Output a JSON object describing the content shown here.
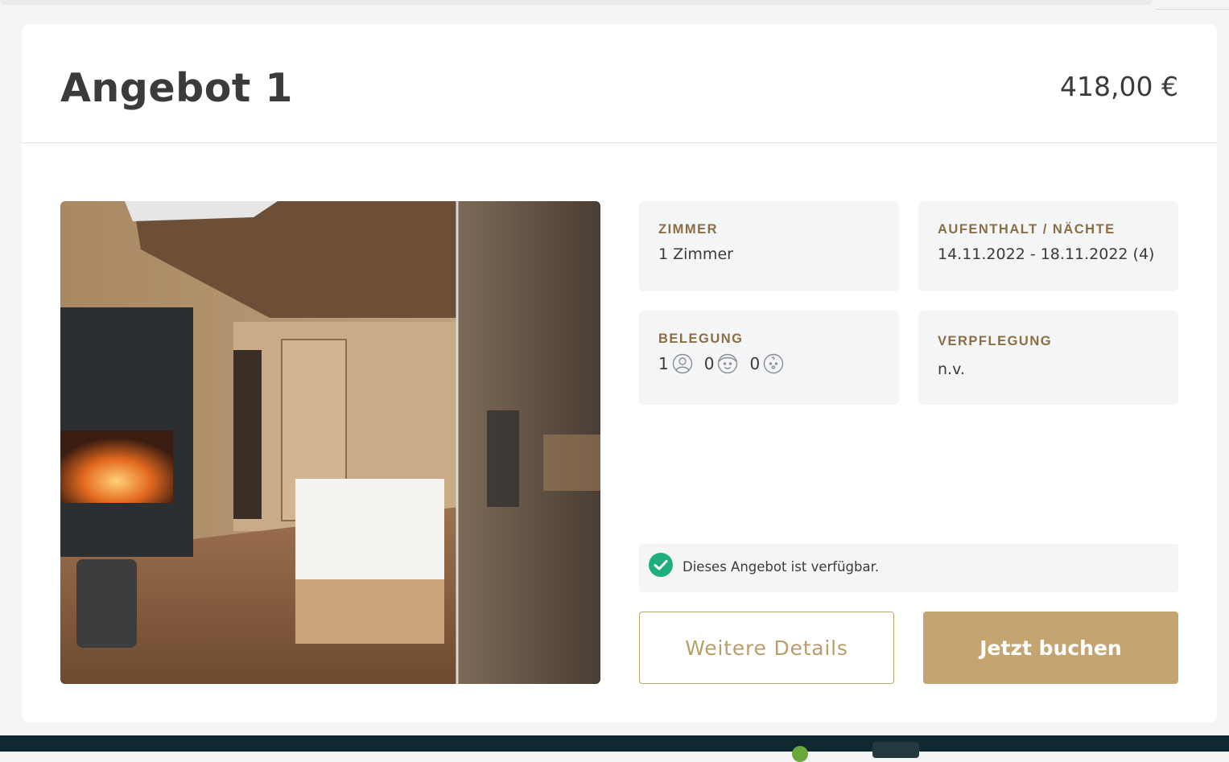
{
  "offer": {
    "title": "Angebot 1",
    "price": "418,00 €",
    "image_alt": "Badezimmer mit Kamin, Badewanne und Sauna in Holzoptik"
  },
  "details": {
    "room": {
      "label": "ZIMMER",
      "value": "1 Zimmer"
    },
    "stay": {
      "label": "AUFENTHALT / NÄCHTE",
      "value": "14.11.2022 - 18.11.2022 (4)"
    },
    "occupancy": {
      "label": "BELEGUNG",
      "adults": "1",
      "children": "0",
      "infants": "0",
      "icons": [
        "adult-icon",
        "child-icon",
        "baby-icon"
      ]
    },
    "board": {
      "label": "VERPFLEGUNG",
      "value": "n.v."
    }
  },
  "availability": {
    "message": "Dieses Angebot ist verfügbar.",
    "status_color": "#1fae7f"
  },
  "actions": {
    "details_label": "Weitere Details",
    "book_label": "Jetzt buchen"
  },
  "colors": {
    "accent": "#c4a572",
    "label": "#8b6e43",
    "footer": "#0e2a30"
  }
}
